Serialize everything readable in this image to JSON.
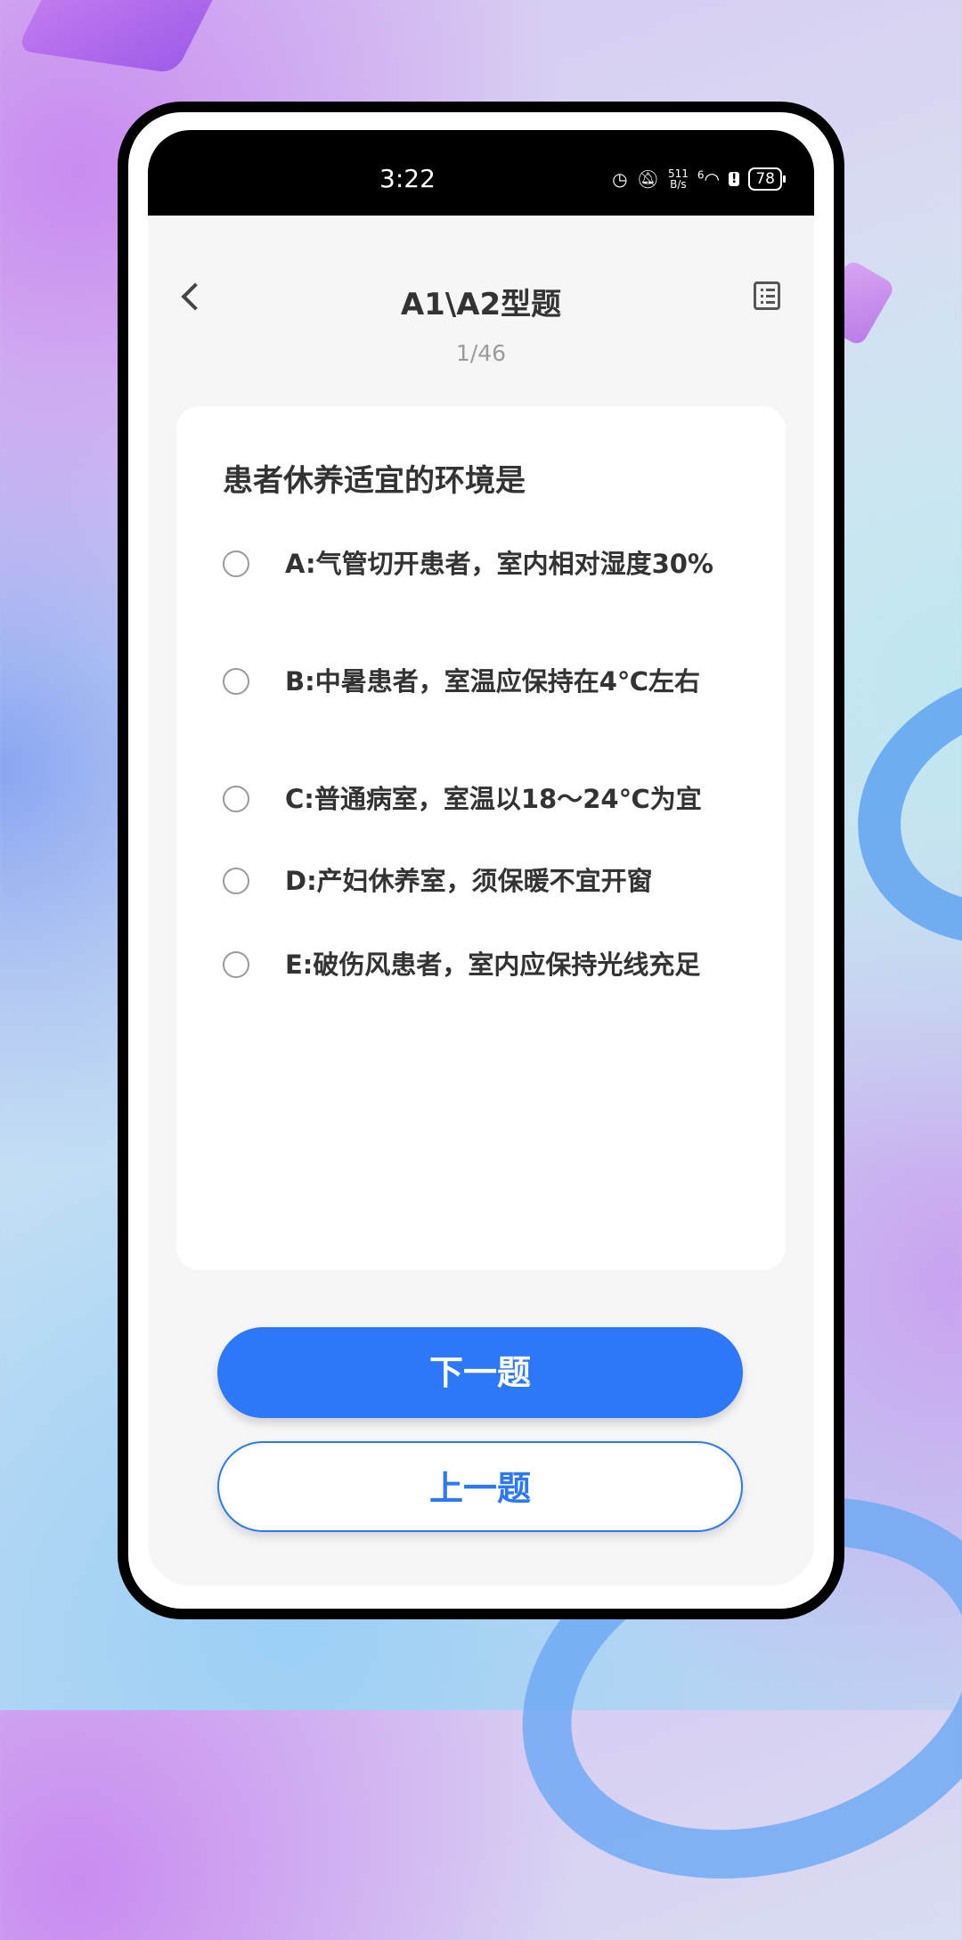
{
  "status_bar": {
    "time": "3:22",
    "net_speed_value": "511",
    "net_speed_unit": "B/s",
    "signal_label": "6",
    "battery": "78"
  },
  "nav": {
    "title": "A1\\A2型题"
  },
  "progress": "1/46",
  "question": {
    "text": "患者休养适宜的环境是",
    "options": [
      {
        "label": "A:气管切开患者，室内相对湿度30%"
      },
      {
        "label": "B:中暑患者，室温应保持在4℃左右"
      },
      {
        "label": "C:普通病室，室温以18～24℃为宜"
      },
      {
        "label": "D:产妇休养室，须保暖不宜开窗"
      },
      {
        "label": "E:破伤风患者，室内应保持光线充足"
      }
    ]
  },
  "buttons": {
    "next_label": "下一题",
    "prev_label": "上一题"
  },
  "colors": {
    "accent": "#2c78f8",
    "status_bar_bg": "#000000",
    "screen_bg": "#f6f6f6"
  }
}
